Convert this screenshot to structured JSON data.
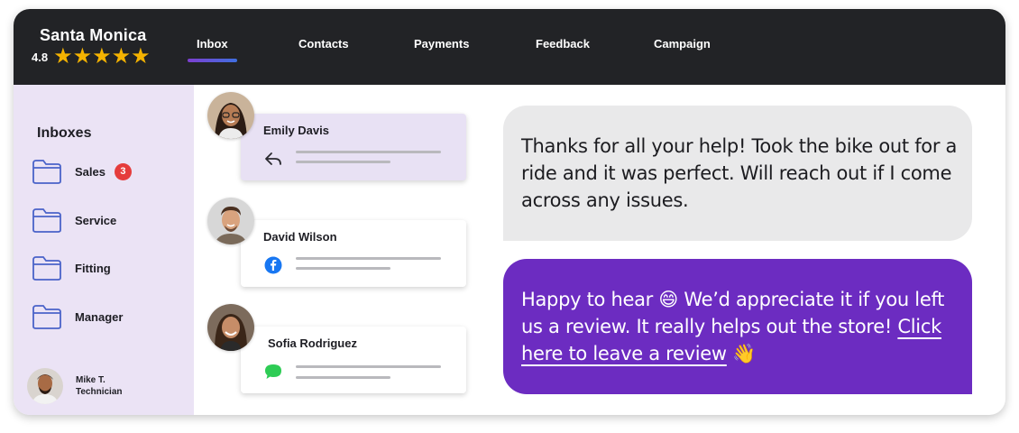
{
  "header": {
    "store_name": "Santa Monica",
    "rating": "4.8",
    "stars": "★★★★★",
    "nav": [
      "Inbox",
      "Contacts",
      "Payments",
      "Feedback",
      "Campaign"
    ],
    "active_tab": "Inbox"
  },
  "sidebar": {
    "title": "Inboxes",
    "items": [
      {
        "label": "Sales",
        "badge": "3"
      },
      {
        "label": "Service"
      },
      {
        "label": "Fitting"
      },
      {
        "label": "Manager"
      }
    ],
    "user": {
      "name": "Mike T.",
      "role": "Technician"
    }
  },
  "conversations": [
    {
      "name": "Emily Davis",
      "channel_icon": "reply-icon",
      "active": true
    },
    {
      "name": "David Wilson",
      "channel_icon": "facebook-icon",
      "active": false
    },
    {
      "name": "Sofia Rodriguez",
      "channel_icon": "sms-icon",
      "active": false
    }
  ],
  "messages": {
    "incoming": "Thanks for all your help! Took the bike out for a ride and it was perfect. Will reach out if I come across any issues.",
    "outgoing_before": "Happy to hear 😄 We’d appreciate it if you left us a review. It really helps out the store! ",
    "outgoing_link": "Click here to leave a review",
    "outgoing_after": " 👋"
  },
  "colors": {
    "topbar": "#222326",
    "sidebar": "#ebe3f5",
    "accent_purple": "#6c2cc1",
    "star": "#f5b301",
    "badge": "#e53c3c"
  }
}
